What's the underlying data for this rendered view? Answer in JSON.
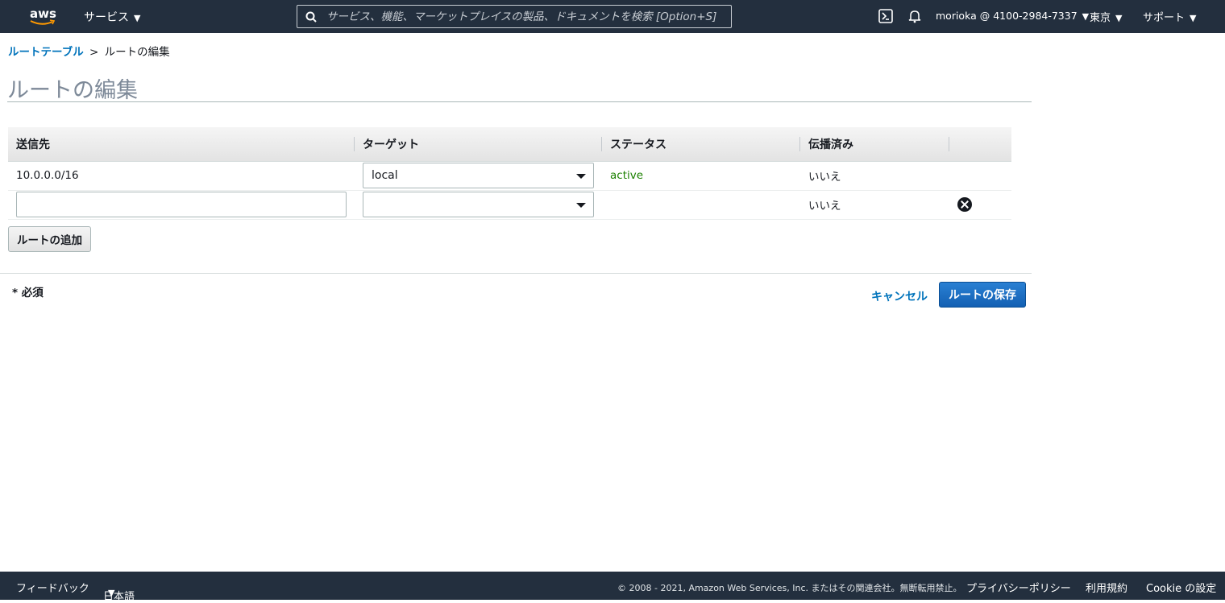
{
  "topnav": {
    "logo_text": "aws",
    "services_label": "サービス",
    "search_placeholder": "サービス、機能、マーケットプレイスの製品、ドキュメントを検索 [Option+S]",
    "account": "morioka @ 4100-2984-7337",
    "region": "東京",
    "support": "サポート"
  },
  "breadcrumb": {
    "parent": "ルートテーブル",
    "separator": ">",
    "current": "ルートの編集"
  },
  "page": {
    "title": "ルートの編集"
  },
  "table": {
    "headers": [
      "送信先",
      "ターゲット",
      "ステータス",
      "伝播済み"
    ],
    "rows": [
      {
        "destination": "10.0.0.0/16",
        "target": "local",
        "status": "active",
        "propagated": "いいえ"
      },
      {
        "destination": "",
        "target": "",
        "status": "",
        "propagated": "いいえ"
      }
    ]
  },
  "actions": {
    "add_route": "ルートの追加",
    "required_note": "* 必須",
    "cancel": "キャンセル",
    "save": "ルートの保存"
  },
  "footer": {
    "feedback": "フィードバック",
    "language": "日本語",
    "copyright": "© 2008 - 2021, Amazon Web Services, Inc. またはその関連会社。無断転用禁止。",
    "privacy": "プライバシーポリシー",
    "terms": "利用規約",
    "cookie": "Cookie の設定"
  },
  "colors": {
    "nav_bg": "#232f3e",
    "link": "#0073bb",
    "status_active": "#1d8102",
    "primary_button": "#1166bb"
  }
}
